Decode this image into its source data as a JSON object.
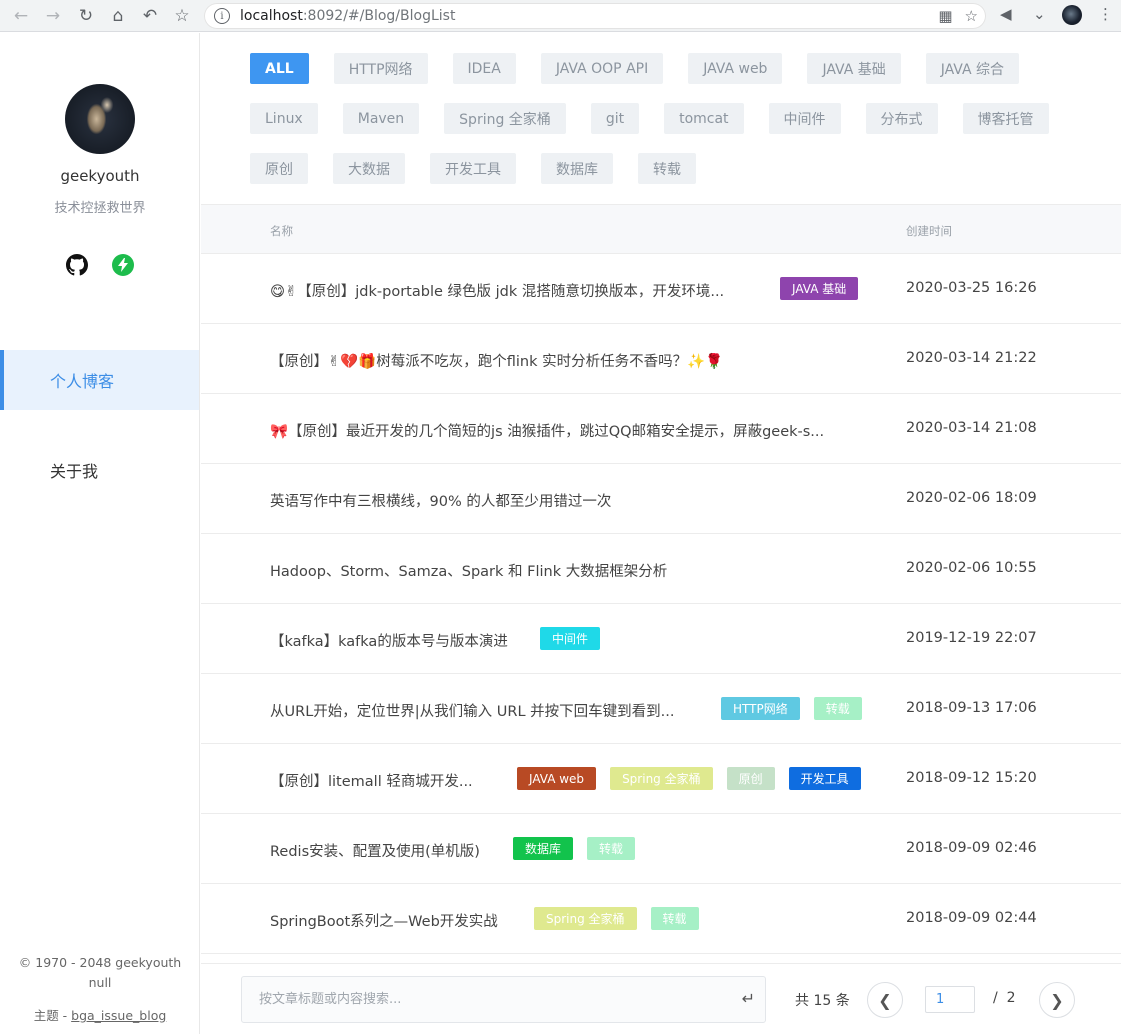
{
  "browser": {
    "url_host": "localhost",
    "url_rest": ":8092/#/Blog/BlogList"
  },
  "sidebar": {
    "username": "geekyouth",
    "motto": "技术控拯救世界",
    "menu": [
      {
        "label": "个人博客",
        "active": true
      },
      {
        "label": "关于我",
        "active": false
      }
    ],
    "footer_copyright": "© 1970 - 2048 geekyouth",
    "footer_null": "null",
    "footer_theme_prefix": "主题 - ",
    "footer_theme_link": "bga_issue_blog"
  },
  "tags": {
    "row1": [
      "ALL",
      "HTTP网络",
      "IDEA",
      "JAVA OOP API",
      "JAVA web",
      "JAVA 基础",
      "JAVA 综合"
    ],
    "row2": [
      "Linux",
      "Maven",
      "Spring 全家桶",
      "git",
      "tomcat",
      "中间件",
      "分布式",
      "博客托管"
    ],
    "row3": [
      "原创",
      "大数据",
      "开发工具",
      "数据库",
      "转载"
    ],
    "active": "ALL"
  },
  "list": {
    "col_name": "名称",
    "col_time": "创建时间",
    "rows": [
      {
        "title": "😋✌【原创】jdk-portable 绿色版 jdk 混搭随意切换版本，开发环境...",
        "time": "2020-03-25 16:26",
        "tags": [
          {
            "label": "JAVA 基础",
            "color": "#8e44ad"
          }
        ]
      },
      {
        "title": "【原创】✌💔🎁树莓派不吃灰，跑个flink 实时分析任务不香吗？✨🌹",
        "time": "2020-03-14 21:22",
        "tags": []
      },
      {
        "title": "🎀【原创】最近开发的几个简短的js 油猴插件，跳过QQ邮箱安全提示，屏蔽geek-s...",
        "time": "2020-03-14 21:08",
        "tags": []
      },
      {
        "title": "英语写作中有三根横线，90% 的人都至少用错过一次",
        "time": "2020-02-06 18:09",
        "tags": []
      },
      {
        "title": "Hadoop、Storm、Samza、Spark 和 Flink 大数据框架分析",
        "time": "2020-02-06 10:55",
        "tags": []
      },
      {
        "title": "【kafka】kafka的版本号与版本演进",
        "time": "2019-12-19 22:07",
        "tags": [
          {
            "label": "中间件",
            "color": "#1fd9e8"
          }
        ]
      },
      {
        "title": "从URL开始，定位世界|从我们输入 URL 并按下回车键到看到...",
        "time": "2018-09-13 17:06",
        "tags": [
          {
            "label": "HTTP网络",
            "color": "#5fc9e2"
          },
          {
            "label": "转载",
            "color": "#a6f0c6"
          }
        ]
      },
      {
        "title": "【原创】litemall 轻商城开发...",
        "time": "2018-09-12 15:20",
        "tags": [
          {
            "label": "JAVA web",
            "color": "#b84a24"
          },
          {
            "label": "Spring 全家桶",
            "color": "#dfe98f"
          },
          {
            "label": "原创",
            "color": "#c5e1c8"
          },
          {
            "label": "开发工具",
            "color": "#0f6de0"
          }
        ]
      },
      {
        "title": "Redis安装、配置及使用(单机版)",
        "time": "2018-09-09 02:46",
        "tags": [
          {
            "label": "数据库",
            "color": "#12c34c"
          },
          {
            "label": "转载",
            "color": "#a6f0c6"
          }
        ]
      },
      {
        "title": "SpringBoot系列之—Web开发实战",
        "time": "2018-09-09 02:44",
        "tags": [
          {
            "label": "Spring 全家桶",
            "color": "#dfe98f"
          },
          {
            "label": "转载",
            "color": "#a6f0c6"
          }
        ]
      }
    ]
  },
  "search": {
    "placeholder": "按文章标题或内容搜索..."
  },
  "pagination": {
    "total_text": "共 15 条",
    "current_page": "1",
    "separator": "/",
    "total_pages": "2"
  }
}
